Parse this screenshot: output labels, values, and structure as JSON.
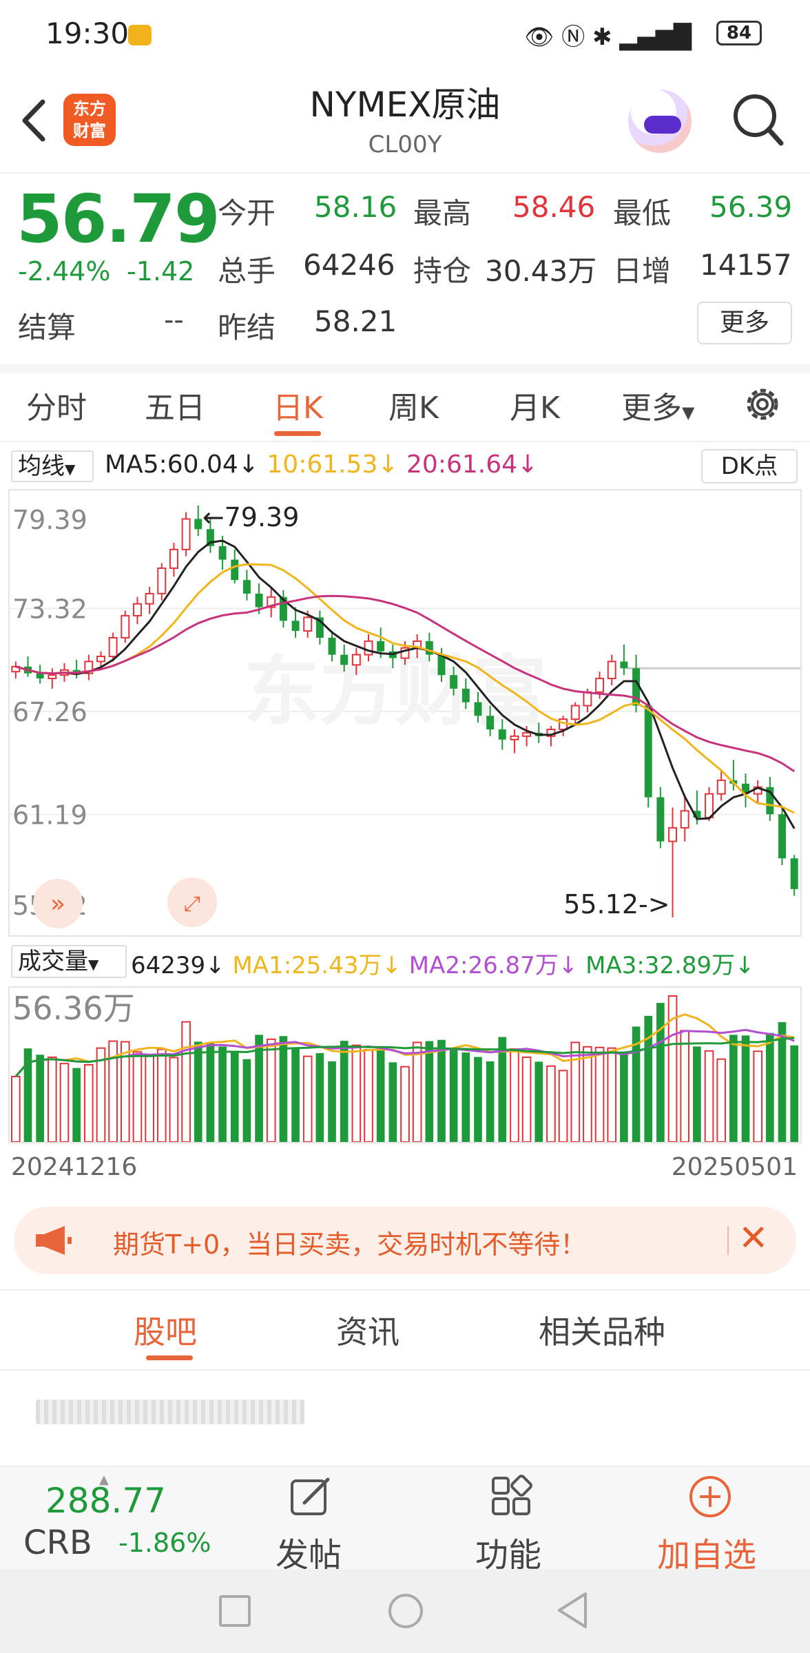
{
  "status_bar": {
    "time": "19:30",
    "battery": "84"
  },
  "header": {
    "title": "NYMEX原油",
    "subtitle": "CL00Y"
  },
  "quote": {
    "price": "56.79",
    "pct_change": "-2.44%",
    "change": "-1.42",
    "settle_label": "结算",
    "settle_value": "--",
    "open_label": "今开",
    "open": "58.16",
    "high_label": "最高",
    "high": "58.46",
    "low_label": "最低",
    "low": "56.39",
    "volume_label": "总手",
    "volume": "64246",
    "oi_label": "持仓",
    "oi": "30.43万",
    "daily_inc_label": "日增",
    "daily_inc": "14157",
    "prev_settle_label": "昨结",
    "prev_settle": "58.21",
    "more_label": "更多"
  },
  "period_tabs": [
    "分时",
    "五日",
    "日K",
    "周K",
    "月K",
    "更多"
  ],
  "active_period": "日K",
  "ma_bar": {
    "select_label": "均线",
    "ma5": "MA5:60.04↓",
    "ma10": "10:61.53↓",
    "ma20": "20:61.64↓",
    "dk_label": "DK点"
  },
  "kline_axis": [
    "79.39",
    "73.32",
    "67.26",
    "61.19",
    "55.12"
  ],
  "kline_annotations": {
    "high": "←79.39",
    "low": "55.12->"
  },
  "volume_bar": {
    "select_label": "成交量",
    "vol": "64239↓",
    "ma1": "MA1:25.43万↓",
    "ma2": "MA2:26.87万↓",
    "ma3": "MA3:32.89万↓",
    "max_label": "56.36万"
  },
  "dates": {
    "start": "20241216",
    "end": "20250501"
  },
  "banner": {
    "text": "期货T+0，当日买卖，交易时机不等待！"
  },
  "bottom_tabs": [
    "股吧",
    "资讯",
    "相关品种"
  ],
  "bottom_bar": {
    "crb_value": "288.77",
    "crb_name": "CRB",
    "crb_pct": "-1.86%",
    "post_label": "发帖",
    "func_label": "功能",
    "add_label": "加自选"
  },
  "colors": {
    "up": "#e3333a",
    "down": "#1f9a3a",
    "accent": "#e8643a",
    "ma5": "#222222",
    "ma10": "#f0b51c",
    "ma20": "#c8327d"
  },
  "chart_data": {
    "type": "candlestick",
    "x_range": [
      "20241216",
      "20250501"
    ],
    "ylim": [
      55.12,
      79.39
    ],
    "candles_ohlc": [
      [
        69.6,
        70.2,
        69.2,
        69.9
      ],
      [
        69.9,
        70.5,
        69.3,
        69.5
      ],
      [
        69.5,
        70.0,
        68.9,
        69.2
      ],
      [
        69.2,
        69.8,
        68.6,
        69.4
      ],
      [
        69.4,
        70.1,
        69.0,
        69.7
      ],
      [
        69.7,
        70.3,
        69.2,
        69.5
      ],
      [
        69.5,
        70.6,
        69.1,
        70.2
      ],
      [
        70.2,
        70.8,
        69.7,
        70.5
      ],
      [
        70.5,
        71.9,
        70.2,
        71.6
      ],
      [
        71.6,
        73.2,
        71.3,
        72.9
      ],
      [
        72.9,
        74.0,
        72.4,
        73.6
      ],
      [
        73.6,
        74.6,
        73.0,
        74.2
      ],
      [
        74.2,
        76.0,
        73.8,
        75.7
      ],
      [
        75.7,
        77.2,
        75.2,
        76.8
      ],
      [
        76.8,
        79.0,
        76.4,
        78.6
      ],
      [
        78.6,
        79.39,
        77.6,
        78.0
      ],
      [
        78.0,
        78.6,
        76.6,
        77.0
      ],
      [
        77.0,
        77.6,
        75.6,
        76.2
      ],
      [
        76.2,
        76.8,
        74.8,
        75.0
      ],
      [
        75.0,
        75.6,
        73.8,
        74.2
      ],
      [
        74.2,
        74.8,
        73.0,
        73.4
      ],
      [
        73.4,
        74.6,
        72.8,
        74.0
      ],
      [
        74.0,
        74.4,
        72.2,
        72.6
      ],
      [
        72.6,
        73.4,
        71.6,
        72.0
      ],
      [
        72.0,
        73.2,
        71.6,
        72.8
      ],
      [
        72.8,
        73.2,
        71.2,
        71.6
      ],
      [
        71.6,
        72.0,
        70.2,
        70.6
      ],
      [
        70.6,
        71.2,
        69.6,
        70.0
      ],
      [
        70.0,
        71.0,
        69.4,
        70.6
      ],
      [
        70.6,
        71.8,
        70.2,
        71.4
      ],
      [
        71.4,
        72.2,
        70.4,
        70.8
      ],
      [
        70.8,
        71.2,
        69.8,
        70.4
      ],
      [
        70.4,
        71.4,
        70.0,
        71.0
      ],
      [
        71.0,
        71.8,
        70.4,
        71.4
      ],
      [
        71.4,
        71.9,
        70.2,
        70.6
      ],
      [
        70.6,
        71.0,
        69.0,
        69.4
      ],
      [
        69.4,
        69.9,
        68.2,
        68.6
      ],
      [
        68.6,
        69.2,
        67.4,
        67.8
      ],
      [
        67.8,
        68.4,
        66.6,
        67.0
      ],
      [
        67.0,
        67.6,
        65.8,
        66.2
      ],
      [
        66.2,
        66.8,
        65.0,
        65.6
      ],
      [
        65.6,
        66.2,
        64.8,
        65.8
      ],
      [
        65.8,
        66.4,
        65.2,
        66.0
      ],
      [
        66.0,
        66.6,
        65.4,
        65.8
      ],
      [
        65.8,
        66.4,
        65.2,
        66.2
      ],
      [
        66.2,
        67.0,
        65.8,
        66.8
      ],
      [
        66.8,
        67.8,
        66.4,
        67.6
      ],
      [
        67.6,
        68.6,
        67.2,
        68.4
      ],
      [
        68.4,
        69.6,
        68.0,
        69.2
      ],
      [
        69.2,
        70.6,
        68.8,
        70.2
      ],
      [
        70.2,
        71.2,
        69.4,
        69.8
      ],
      [
        69.8,
        70.6,
        67.2,
        67.6
      ],
      [
        67.6,
        67.8,
        61.6,
        62.2
      ],
      [
        62.2,
        62.8,
        59.2,
        59.6
      ],
      [
        59.6,
        61.6,
        55.12,
        60.4
      ],
      [
        60.4,
        62.2,
        59.6,
        61.4
      ],
      [
        61.4,
        62.6,
        60.6,
        61.0
      ],
      [
        61.0,
        62.8,
        60.8,
        62.4
      ],
      [
        62.4,
        63.8,
        62.0,
        63.2
      ],
      [
        63.2,
        64.4,
        62.6,
        63.0
      ],
      [
        63.0,
        63.6,
        61.6,
        62.4
      ],
      [
        62.4,
        63.2,
        61.8,
        62.8
      ],
      [
        62.8,
        63.4,
        60.8,
        61.2
      ],
      [
        61.2,
        61.6,
        58.2,
        58.6
      ],
      [
        58.6,
        58.8,
        56.39,
        56.79
      ]
    ],
    "ma_lines": [
      "MA5",
      "MA10",
      "MA20"
    ]
  }
}
